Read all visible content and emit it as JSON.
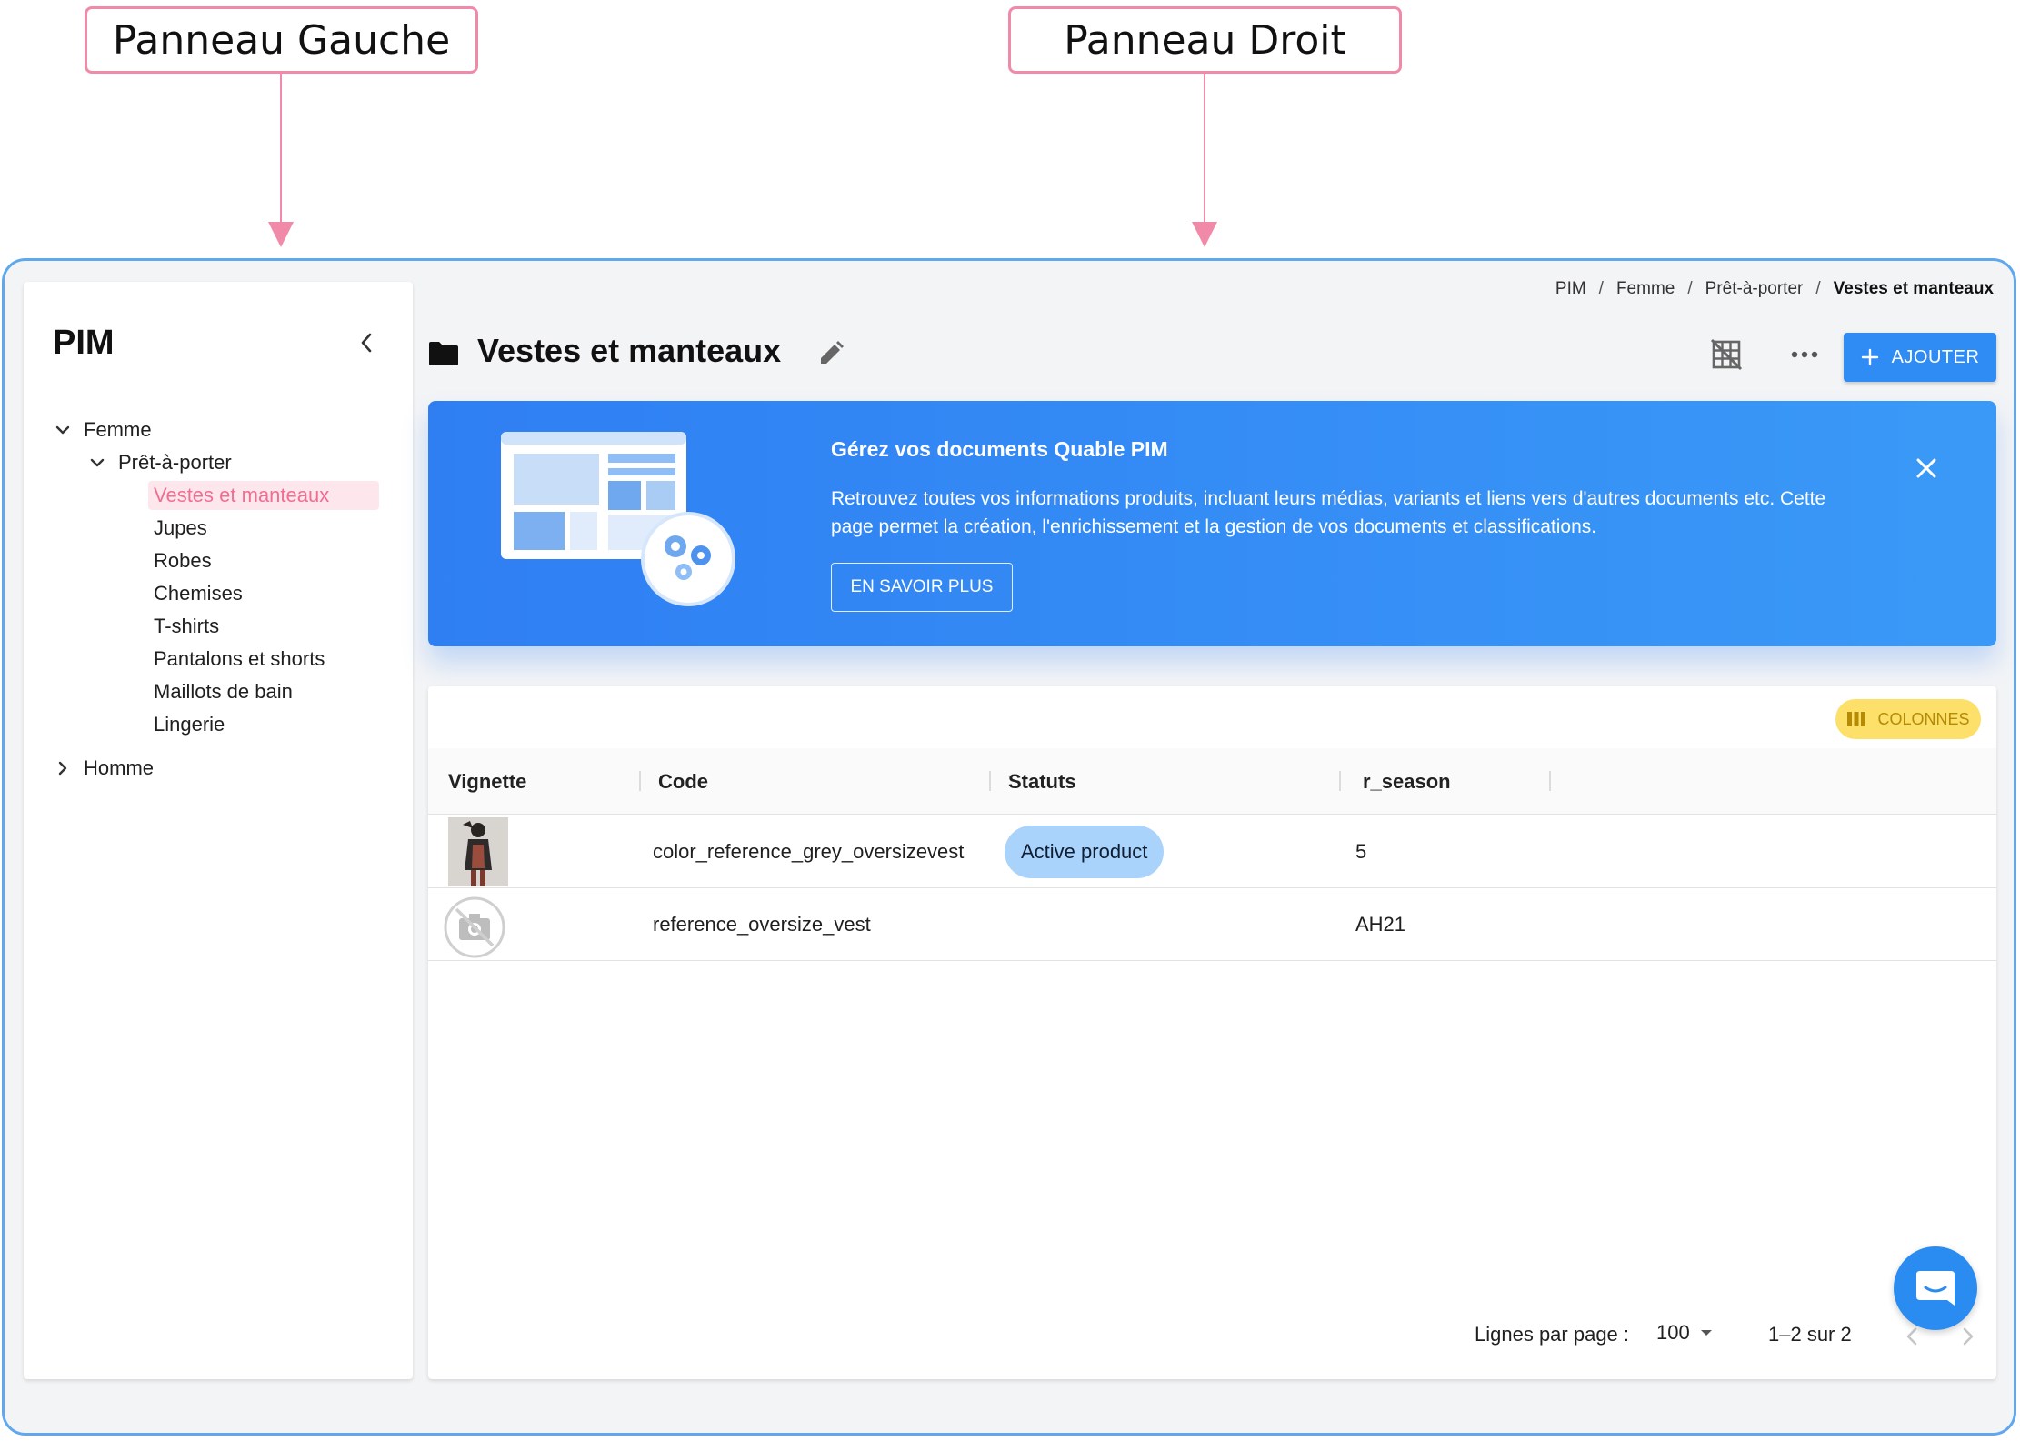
{
  "annotations": {
    "left_label": "Panneau Gauche",
    "right_label": "Panneau Droit"
  },
  "sidebar": {
    "title": "PIM",
    "tree": {
      "femme": "Femme",
      "pret_a_porter": "Prêt-à-porter",
      "children": [
        "Vestes et manteaux",
        "Jupes",
        "Robes",
        "Chemises",
        "T-shirts",
        "Pantalons et shorts",
        "Maillots de bain",
        "Lingerie"
      ],
      "homme": "Homme"
    },
    "selected": "Vestes et manteaux"
  },
  "breadcrumb": [
    "PIM",
    "Femme",
    "Prêt-à-porter",
    "Vestes et manteaux"
  ],
  "breadcrumb_separator": "/",
  "header": {
    "title": "Vestes et manteaux",
    "add_label": "AJOUTER"
  },
  "banner": {
    "title": "Gérez vos documents Quable PIM",
    "text": "Retrouvez toutes vos informations produits, incluant leurs médias, variants et liens vers d'autres documents etc. Cette page permet la création, l'enrichissement et la gestion de vos documents et classifications.",
    "button_label": "EN SAVOIR PLUS"
  },
  "table": {
    "columns_button": "COLONNES",
    "headers": [
      "Vignette",
      "Code",
      "Statuts",
      "r_season"
    ],
    "rows": [
      {
        "thumbnail": "photo",
        "code": "color_reference_grey_oversizevest",
        "status": "Active product",
        "season": "5"
      },
      {
        "thumbnail": "no-photo",
        "code": "reference_oversize_vest",
        "status": "",
        "season": "AH21"
      }
    ]
  },
  "pagination": {
    "rows_label": "Lignes par page :",
    "rows_value": "100",
    "range": "1–2 sur 2"
  },
  "colors": {
    "accent": "#2f8cf5",
    "selected_text": "#ef6f94",
    "status_pill": "#a9d3fb",
    "columns_button": "#fde06a",
    "annotation": "#f08aa8",
    "frame_border": "#5fa8ee"
  }
}
